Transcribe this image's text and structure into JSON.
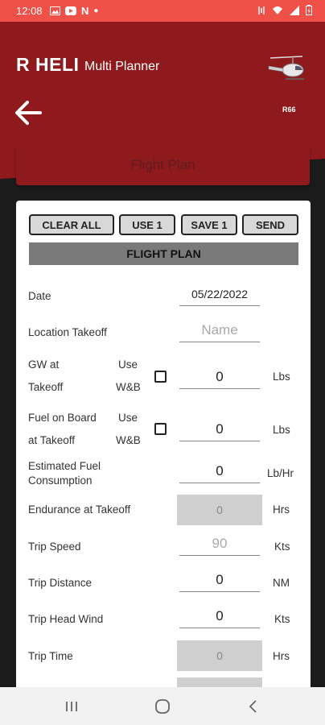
{
  "status": {
    "time": "12:08",
    "battery_icon": "battery-charging-icon"
  },
  "app": {
    "title": "R HELI",
    "subtitle": "Multi Planner",
    "aircraft": "R66"
  },
  "nav_button": "Flight Plan",
  "actions": {
    "clear": "CLEAR ALL",
    "use": "USE 1",
    "save": "SAVE 1",
    "send": "SEND"
  },
  "section": "FLIGHT PLAN",
  "form": {
    "date_label": "Date",
    "date_value": "05/22/2022",
    "location_label": "Location Takeoff",
    "location_placeholder": "Name",
    "gw_label_1": "GW at",
    "gw_label_2": "Takeoff",
    "gw_use_1": "Use",
    "gw_use_2": "W&B",
    "gw_value": "0",
    "gw_unit": "Lbs",
    "fob_label_1": "Fuel on Board",
    "fob_label_2": "at Takeoff",
    "fob_use_1": "Use",
    "fob_use_2": "W&B",
    "fob_value": "0",
    "fob_unit": "Lbs",
    "efc_label_1": "Estimated Fuel",
    "efc_label_2": "Consumption",
    "efc_value": "0",
    "efc_unit": "Lb/Hr",
    "end_label": "Endurance at Takeoff",
    "end_value": "0",
    "end_unit": "Hrs",
    "speed_label": "Trip Speed",
    "speed_placeholder": "90",
    "speed_unit": "Kts",
    "dist_label": "Trip Distance",
    "dist_value": "0",
    "dist_unit": "NM",
    "wind_label": "Trip Head Wind",
    "wind_value": "0",
    "wind_unit": "Kts",
    "time_label": "Trip Time",
    "time_value": "0",
    "time_unit": "Hrs"
  },
  "colors": {
    "header_red": "#8f1a1d",
    "status_red": "#ef5149",
    "dark_bg": "#1b1b1b"
  }
}
